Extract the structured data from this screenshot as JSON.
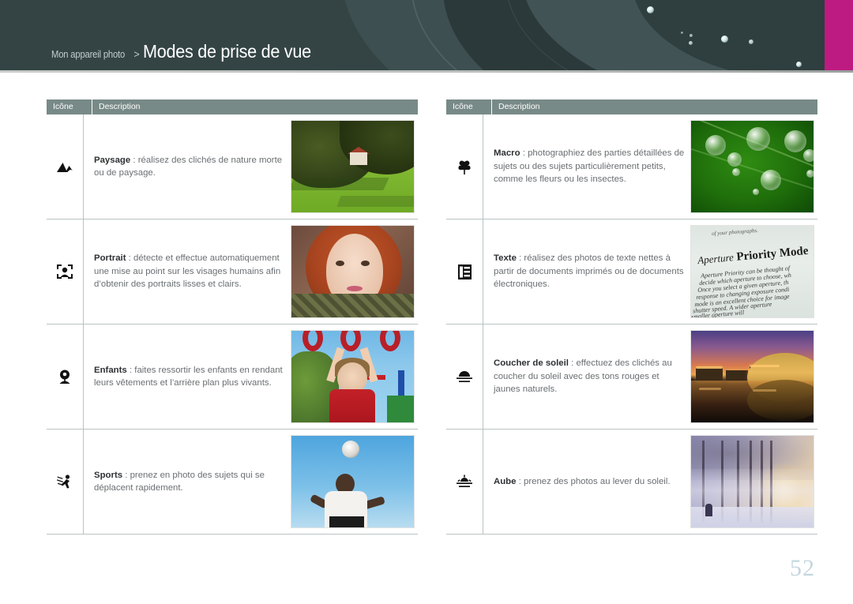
{
  "header": {
    "breadcrumb": "Mon appareil photo",
    "separator": ">",
    "title": "Modes de prise de vue",
    "accent_magenta": "#bd1b82",
    "background": "#344445"
  },
  "table_headers": {
    "icon": "Icône",
    "description": "Description"
  },
  "left_table": {
    "rows": [
      {
        "icon": "landscape-mountain-icon",
        "term": "Paysage",
        "colon": " : ",
        "description": "réalisez des clichés de nature morte ou de paysage.",
        "photo": "landscape-lawn-trees-house-photo"
      },
      {
        "icon": "portrait-face-detect-icon",
        "term": "Portrait",
        "colon": " : ",
        "description": "détecte et effectue automatiquement une mise au point sur les visages humains afin d’obtenir des portraits lisses et clairs.",
        "photo": "portrait-red-haired-girl-photo"
      },
      {
        "icon": "children-icon",
        "term": "Enfants",
        "colon": " : ",
        "description": "faites ressortir les enfants en rendant leurs vêtements et l’arrière plan plus vivants.",
        "photo": "child-on-playground-rings-photo"
      },
      {
        "icon": "sports-running-icon",
        "term": "Sports",
        "colon": " : ",
        "description": "prenez en photo des sujets qui se déplacent rapidement.",
        "photo": "soccer-player-heading-ball-photo"
      }
    ]
  },
  "right_table": {
    "rows": [
      {
        "icon": "macro-flower-icon",
        "term": "Macro",
        "colon": " : ",
        "description": "photographiez des parties détaillées de sujets ou des sujets particulièrement petits, comme les fleurs ou les insectes.",
        "photo": "water-droplets-on-green-leaf-photo"
      },
      {
        "icon": "text-document-icon",
        "term": "Texte",
        "colon": " : ",
        "description": "réalisez des photos de texte nettes à partir de documents imprimés ou de documents électroniques.",
        "photo": "printed-book-page-photo",
        "photo_text": {
          "top_line": "of your photographs.",
          "heading_italic": "Aperture",
          "heading_bold": "Priority Mode",
          "body_lines": [
            "Aperture Priority can be thought of",
            "decide which aperture to choose, wh",
            "Once you select a given aperture, th",
            "response to changing exposure condi",
            "mode is an excellent choice for image",
            "shutter speed. A wider aperture",
            "smaller aperture will"
          ]
        }
      },
      {
        "icon": "sunset-icon",
        "term": "Coucher de soleil",
        "colon": " : ",
        "description": "effectuez des clichés au coucher du soleil avec des tons rouges et jaunes naturels.",
        "photo": "sunset-city-dome-reflection-photo"
      },
      {
        "icon": "dawn-sunrise-icon",
        "term": "Aube",
        "colon": " : ",
        "description": "prenez des photos au lever du soleil.",
        "photo": "misty-winter-dawn-trees-photo"
      }
    ]
  },
  "footer": {
    "page_number": "52"
  }
}
